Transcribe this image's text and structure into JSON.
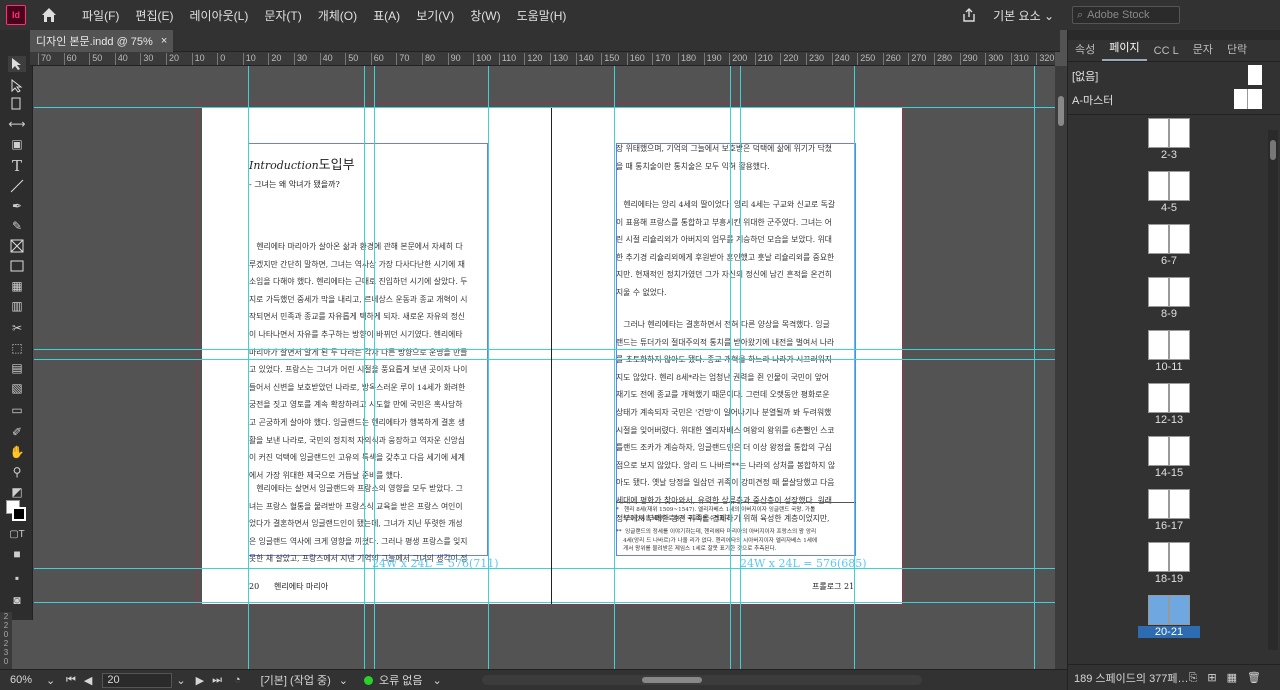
{
  "menubar": {
    "app_logo": "Id",
    "items": [
      "파일(F)",
      "편집(E)",
      "레이아웃(L)",
      "문자(T)",
      "개체(O)",
      "표(A)",
      "보기(V)",
      "창(W)",
      "도움말(H)"
    ],
    "workspace": "기본 요소 ⌄",
    "stock_placeholder": "Adobe Stock"
  },
  "document_tab": {
    "title": "디자인 본문.indd @ 75%",
    "close": "×"
  },
  "ruler_ticks": [
    "70",
    "60",
    "50",
    "40",
    "30",
    "20",
    "10",
    "0",
    "10",
    "20",
    "30",
    "40",
    "50",
    "60",
    "70",
    "80",
    "90",
    "100",
    "110",
    "120",
    "130",
    "140",
    "150",
    "160",
    "170",
    "180",
    "190",
    "200",
    "210",
    "220",
    "230",
    "240",
    "250",
    "260",
    "270",
    "280",
    "290",
    "300",
    "310",
    "320"
  ],
  "panel": {
    "tabs": [
      "속성",
      "페이지",
      "CC L",
      "문자",
      "단락"
    ],
    "active_tab": "페이지",
    "masters": [
      "[없음]",
      "A-마스터"
    ],
    "spreads": [
      "2-3",
      "4-5",
      "6-7",
      "8-9",
      "10-11",
      "12-13",
      "14-15",
      "16-17",
      "18-19",
      "20-21"
    ],
    "selected_spread": "20-21",
    "footer": "189 스페이드의 377페…"
  },
  "status": {
    "zoom": "60%",
    "page": "20",
    "preflight_profile": "[기본] (작업 중)",
    "errors": "오류 없음"
  },
  "left_page": {
    "heading_en": "Introduction",
    "heading_ko": "도입부",
    "subtitle": "- 그녀는 왜 악녀가 됐을까?",
    "para1": "   헨리에타 마리아가 살아온 삶과 환경에 관해 본문에서 자세히 다\n루겠지만 간단히 말하면, 그녀는 역사상 가장 다사다난한 시기에 재\n소임을 다해야 했다. 헨리에타는 근대로 진입하던 시기에 살았다. 두\n지로 가득했던 중세가 막을 내리고, 르네상스 운동과 종교 개혁이 시\n작되면서 민족과 종교를 자유롭게 택하게 되자. 새로운 자유의 정신\n이 나타나면서 자유를 추구하는 방향이 바뀌던 시기였다. 헨리에타\n마리아가 살면서 알게 된 두 나라는 각자 다른 방향으로 운명을 만들\n고 있었다. 프랑스는 그녀가 어린 시절을 풍요롭게 보낸 곳이자 나이\n들어서 신변을 보호받았던 나라로, 방옥스러운 루이 14세가 화려한\n궁전을 짓고 영토를 계속 확장하려고 시도할 만에 국민은 혹사당하\n고 곤궁하게 살아야 했다. 잉글랜드는 헨리에타가 행복하게 결혼 생\n활을 보낸 나라로, 국민의 정치적 자의식과 웅장하고 역자운 신앙심\n이 커진 덕택에 잉글랜드인 고유의 특색을 갖추고 다음 세기에 세계\n에서 가장 위대한 제국으로 거듭날 준비를 했다.",
    "para2": "   헨리에타는 살면서 잉글랜드와 프랑스의 영향을 모두 받았다. 그\n녀는 프랑스 혈통을 물려받아 프랑스식 교육을 받은 프랑스 여인이\n었다가 결혼하면서 잉글랜드인이 됐는데, 그녀가 지닌 뚜렷한 개성\n은 잉글랜드 역사에 크게 영향을 끼쳤다. 그러나 평생 프랑스를 잊지\n못한 채 살았고, 프랑스에서 지낸 기억의 그늘에서 그녀의 생각이 정",
    "word_count": "24W x 24L = 576(711)",
    "folio_num": "20",
    "folio_title": "헨리에타 마리아"
  },
  "right_page": {
    "para0": "장 위태했으며, 기억의 그늘에서 보호받은 덕택에 삶에 위기가 닥쳤\n을 때 통치술이란 통치술은 모두 익혀 활용했다.",
    "para1": "   헨리에타는 앙리 4세의 딸이었다. 앙리 4세는 구교와 신교로 독갈\n이 표용해 프랑스를 통합하고 부흥시킨 위대한 군주였다. 그녀는 어\n린 시절 리슐리외가 아버지의 업무를 계승하던 모습을 보았다. 위대\n한 추기경 리슐리외에게 후원받아 혼인했고 훗날 리슐리외를 중요한\n지만. 현재적인 정치가였던 그가 자신의 정신에 남긴 흔적을 온건히\n지울 수 없었다.",
    "para2": "   그러나 헨리에타는 결혼하면서 전혀 다른 양상을 목격했다. 잉글\n랜드는 튜더가의 절대주의적 통치를 받아왔기에 내전을 벌여서 나라\n를 초토화하지 않아도 됐다. 종교 개혁을 하느라 나라가 시끄러워지\n지도 않았다. 헨리 8세*라는 엄청난 권력을 쥔 인물이 국민이 앞어\n재기도 전에 종교를 개혁했기 때문이다. 그런데 오랫동안 평화로운\n상태가 계속되자 국민은 '건망'이 일어나기나 분열될까 봐 두려워했\n시절을 잊어버렸다. 위대한 엘리자베스 여왕의 왕위를 6촌뻘인 스코\n틀랜드 조카가 계승하자, 잉글랜드인은 더 이상 왕정을 통합의 구심\n점으로 보지 않았다. 앙리 드 나바르**는 나라의 상처를 봉합하지 않\n아도 됐다. 옛날 당정을 일삼던 귀족이 강미견정 때 몰살당했고 다음\n세대에 평화가 찾아와서, 유력한 상류층과 중산층이 성장했다. 원래\n정부에서 부패한 봉건 귀족을 견제하기 위해 육성한 계층이었지만,",
    "footnote1": "*   헨리 8세(재위 1509~1547). 엘리자베스 1세의 아버지이자 잉글랜드 국왕. 가톨\n    릭의 전통을 바탕으로 영국 국교회를 수립했다.",
    "footnote2": "**  잉글랜드의 정세를 이야기하는데, 헨리에타 마리아의 아버지이자 프랑스의 왕 앙리\n    4세(앙리 드 나바르)가 나올 리가 없다. 헨리에타의 시아버지이자 엘리자베스 1세에\n    게서 왕위를 물려받은 제임스 1세로 잘못 표기한 것으로 추측된다.",
    "word_count": "24W x 24L = 576(685)",
    "folio_title": "프롤로그",
    "folio_num": "21"
  }
}
